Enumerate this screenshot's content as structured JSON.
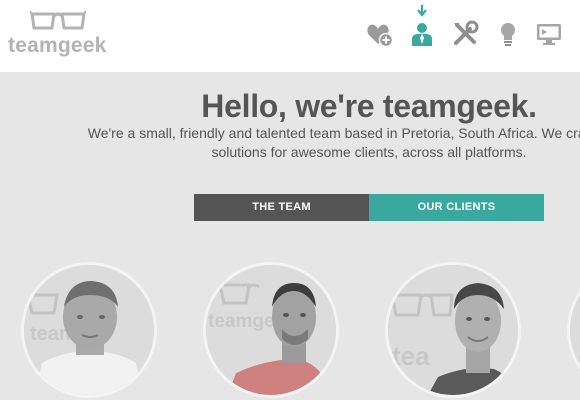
{
  "logo": {
    "text": "teamgeek",
    "icon": "glasses-icon"
  },
  "nav": {
    "items": [
      {
        "icon": "heart-plus-icon",
        "active": false
      },
      {
        "icon": "user-icon",
        "active": true
      },
      {
        "icon": "tools-icon",
        "active": false
      },
      {
        "icon": "lightbulb-icon",
        "active": false
      },
      {
        "icon": "monitor-icon",
        "active": false
      }
    ]
  },
  "hero": {
    "title": "Hello, we're teamgeek.",
    "line1": "We're a small, friendly and talented team based in Pretoria, South Africa. We craft beautiful",
    "line2": "solutions for awesome clients, across all platforms."
  },
  "tabs": {
    "team": "THE TEAM",
    "clients": "OUR CLIENTS"
  },
  "team": {
    "members": [
      {
        "shirt_color": "#ffffff"
      },
      {
        "shirt_color": "#cf6f6f"
      },
      {
        "shirt_color": "#5a5a5a"
      }
    ]
  },
  "colors": {
    "accent": "#3aa89f",
    "dark": "#555555",
    "background": "#e6e6e6",
    "header": "#ffffff"
  }
}
